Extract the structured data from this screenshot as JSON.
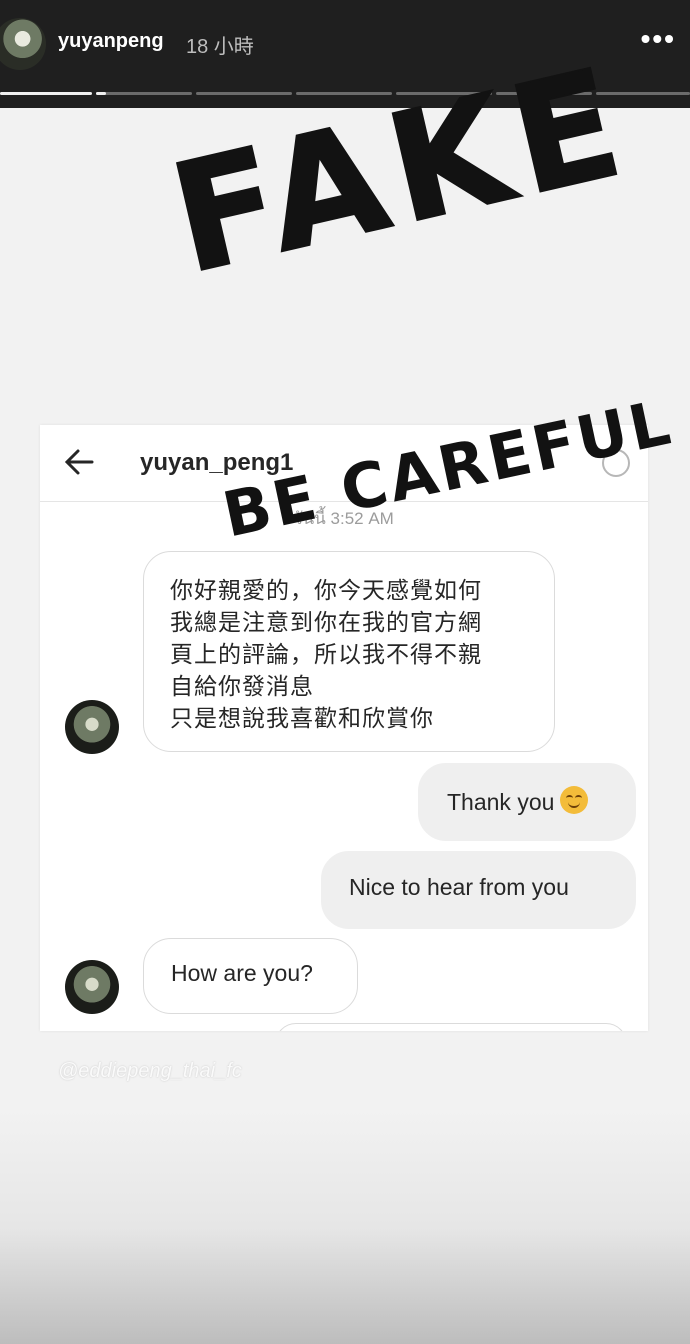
{
  "header": {
    "username": "yuyanpeng",
    "time": "18 小時",
    "more_label": "•••",
    "story_progress": {
      "segments": 7,
      "active_index": 0,
      "active_fill": 1.0,
      "next_fill": 0.1
    }
  },
  "overlay": {
    "fake": "FAKE",
    "careful": "BE CAREFUL"
  },
  "chat": {
    "username": "yuyan_peng1",
    "timestamp": "วันนี้ 3:52 AM",
    "messages": [
      {
        "sender": "them",
        "lines": [
          "你好親愛的，你今天感覺如何",
          "我總是注意到你在我的官方網",
          "頁上的評論，所以我不得不親",
          "自給你發消息",
          "只是想說我喜歡和欣賞你"
        ]
      },
      {
        "sender": "me",
        "text": "Thank you",
        "emoji": "smiling-face"
      },
      {
        "sender": "me",
        "text": "Nice to hear from you"
      },
      {
        "sender": "them",
        "text": "How are you?"
      }
    ]
  },
  "watermark": "@eddiepeng_thai_fc",
  "colors": {
    "topbar": "#1f1f1f",
    "background": "#f2f2f2",
    "bubble_me": "#efefef",
    "ink": "#121212"
  }
}
